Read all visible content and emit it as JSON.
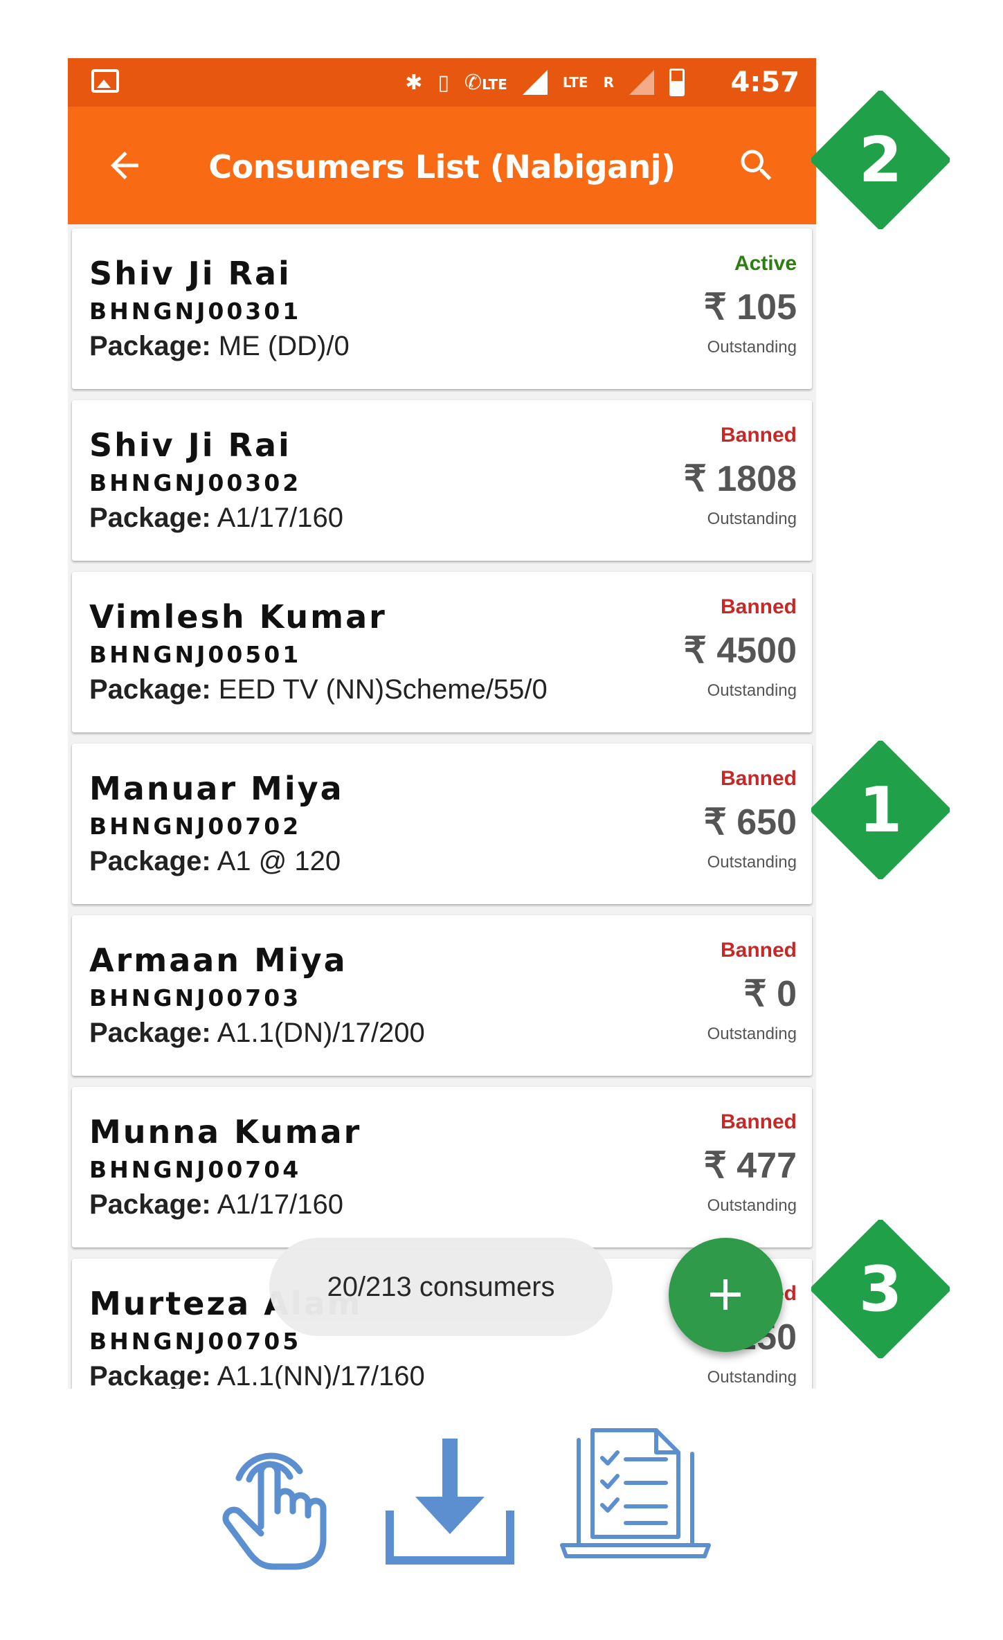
{
  "status_bar": {
    "time": "4:57",
    "icons": [
      "image-icon",
      "bluetooth-icon",
      "vibrate-icon",
      "volte-call-icon",
      "signal-icon",
      "lte-data-icon",
      "roaming-signal-icon",
      "battery-icon"
    ],
    "lte_label": "LTE",
    "lte_data_label": "LTE",
    "roaming_label": "R"
  },
  "app_bar": {
    "title": "Consumers List (Nabiganj)",
    "back_icon": "arrow-back-icon",
    "search_icon": "search-icon",
    "background": "#f96a15"
  },
  "consumers": [
    {
      "name": "Shiv Ji Rai",
      "id": "BHNGNJ00301",
      "package_label": "Package:",
      "package": "ME (DD)/0",
      "status": "Active",
      "amount": "₹ 105",
      "amount_label": "Outstanding"
    },
    {
      "name": "Shiv Ji Rai",
      "id": "BHNGNJ00302",
      "package_label": "Package:",
      "package": "A1/17/160",
      "status": "Banned",
      "amount": "₹ 1808",
      "amount_label": "Outstanding"
    },
    {
      "name": "Vimlesh Kumar",
      "id": "BHNGNJ00501",
      "package_label": "Package:",
      "package": "EED TV (NN)Scheme/55/0",
      "status": "Banned",
      "amount": "₹ 4500",
      "amount_label": "Outstanding"
    },
    {
      "name": "Manuar Miya",
      "id": "BHNGNJ00702",
      "package_label": "Package:",
      "package": "A1 @ 120",
      "status": "Banned",
      "amount": "₹ 650",
      "amount_label": "Outstanding"
    },
    {
      "name": "Armaan Miya",
      "id": "BHNGNJ00703",
      "package_label": "Package:",
      "package": "A1.1(DN)/17/200",
      "status": "Banned",
      "amount": "₹ 0",
      "amount_label": "Outstanding"
    },
    {
      "name": "Munna Kumar",
      "id": "BHNGNJ00704",
      "package_label": "Package:",
      "package": "A1/17/160",
      "status": "Banned",
      "amount": "₹ 477",
      "amount_label": "Outstanding"
    },
    {
      "name": "Murteza Alam",
      "id": "BHNGNJ00705",
      "package_label": "Package:",
      "package": "A1.1(NN)/17/160",
      "status": "Banned",
      "amount": "₹ 250",
      "amount_label": "Outstanding"
    }
  ],
  "toast": {
    "text": "20/213 consumers"
  },
  "fab": {
    "icon": "plus-icon",
    "color": "#2e9a4a"
  },
  "callouts": [
    {
      "number": "1",
      "color": "#20a048"
    },
    {
      "number": "2",
      "color": "#20a048"
    },
    {
      "number": "3",
      "color": "#20a048"
    }
  ],
  "feature_icons": [
    "tap-hand-icon",
    "download-icon",
    "checklist-laptop-icon"
  ],
  "colors": {
    "accent_icon_blue": "#5b8fd0",
    "active_green": "#2e7d12",
    "banned_red": "#c62828"
  }
}
